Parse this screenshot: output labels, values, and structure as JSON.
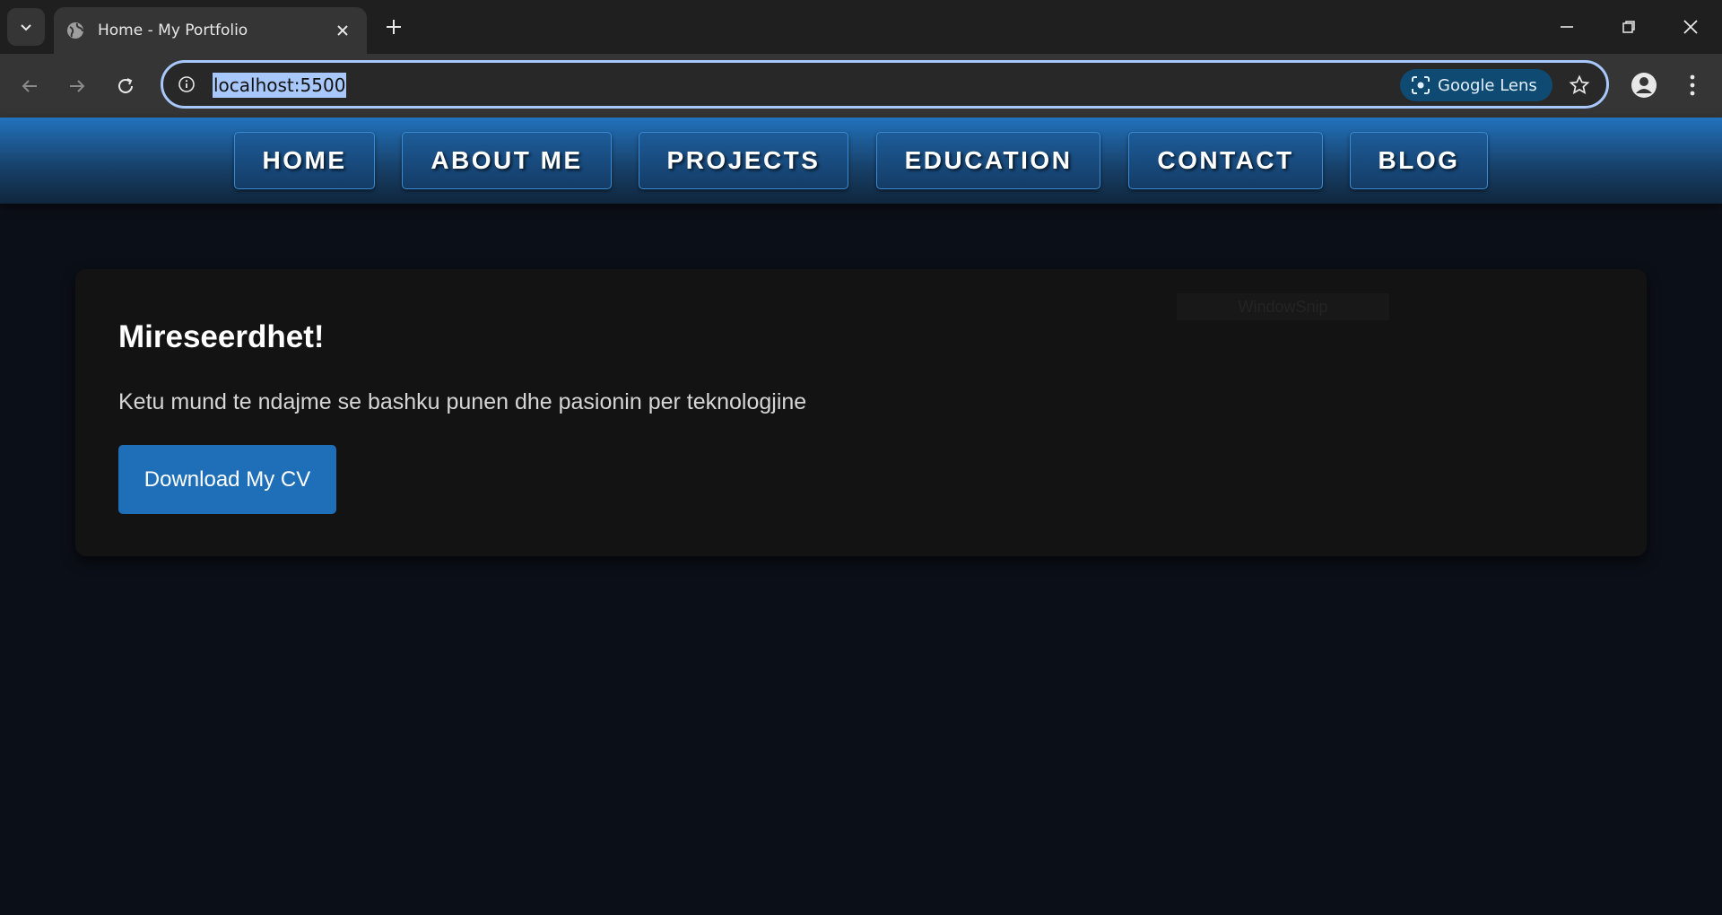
{
  "browser": {
    "tab_title": "Home - My Portfolio",
    "url": "localhost:5500",
    "lens_label": "Google Lens",
    "icons": [
      "tab-search-icon",
      "globe-icon",
      "close-icon",
      "plus-icon",
      "minimize-icon",
      "restore-icon",
      "close-window-icon",
      "back-icon",
      "forward-icon",
      "reload-icon",
      "info-icon",
      "lens-icon",
      "star-icon",
      "profile-icon",
      "kebab-menu-icon"
    ]
  },
  "nav": {
    "items": [
      "HOME",
      "ABOUT ME",
      "PROJECTS",
      "EDUCATION",
      "CONTACT",
      "BLOG"
    ]
  },
  "hero": {
    "heading": "Mireseerdhet!",
    "text": "Ketu mund te ndajme se bashku punen dhe pasionin per teknologjine",
    "button_label": "Download My CV",
    "overlay_text": "WindowSnip"
  },
  "colors": {
    "page_bg": "#0b0f17",
    "card_bg": "#131313",
    "accent": "#1f6fb8",
    "nav_gradient_top": "#2272bd"
  }
}
